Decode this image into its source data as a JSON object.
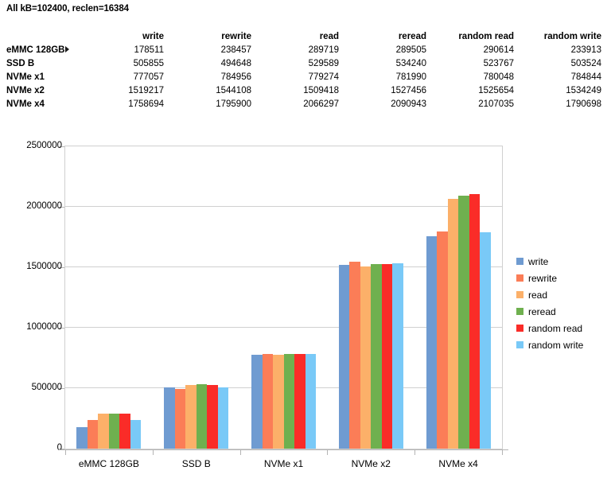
{
  "sheet": {
    "title": "All kB=102400, reclen=16384"
  },
  "table": {
    "corner_label": "",
    "columns": [
      "write",
      "rewrite",
      "read",
      "reread",
      "random read",
      "random write"
    ],
    "rows": [
      {
        "label": "eMMC 128GB",
        "values": [
          178511,
          238457,
          289719,
          289505,
          290614,
          233913
        ],
        "truncated": true
      },
      {
        "label": "SSD B",
        "values": [
          505855,
          494648,
          529589,
          534240,
          523767,
          503524
        ],
        "truncated": false
      },
      {
        "label": "NVMe x1",
        "values": [
          777057,
          784956,
          779274,
          781990,
          780048,
          784844
        ],
        "truncated": false
      },
      {
        "label": "NVMe x2",
        "values": [
          1519217,
          1544108,
          1509418,
          1527456,
          1525654,
          1534249
        ],
        "truncated": false
      },
      {
        "label": "NVMe x4",
        "values": [
          1758694,
          1795900,
          2066297,
          2090943,
          2107035,
          1790698
        ],
        "truncated": false
      }
    ]
  },
  "chart_data": {
    "type": "bar",
    "title": "",
    "xlabel": "",
    "ylabel": "",
    "categories": [
      "eMMC 128GB",
      "SSD B",
      "NVMe x1",
      "NVMe x2",
      "NVMe x4"
    ],
    "series": [
      {
        "name": "write",
        "color": "#6f9bd1",
        "values": [
          178511,
          505855,
          777057,
          1519217,
          1758694
        ]
      },
      {
        "name": "rewrite",
        "color": "#fb7d57",
        "values": [
          238457,
          494648,
          784956,
          1544108,
          1795900
        ]
      },
      {
        "name": "read",
        "color": "#fcb069",
        "values": [
          289719,
          529589,
          779274,
          1509418,
          2066297
        ]
      },
      {
        "name": "reread",
        "color": "#6fb04f",
        "values": [
          289505,
          534240,
          781990,
          1527456,
          2090943
        ]
      },
      {
        "name": "random read",
        "color": "#fa2c28",
        "values": [
          290614,
          523767,
          780048,
          1525654,
          2107035
        ]
      },
      {
        "name": "random write",
        "color": "#79c9f7",
        "values": [
          233913,
          503524,
          784844,
          1534249,
          1790698
        ]
      }
    ],
    "ylim": [
      0,
      2500000
    ],
    "yticks": [
      0,
      500000,
      1000000,
      1500000,
      2000000,
      2500000
    ],
    "ytick_labels": [
      "0",
      "500000",
      "1000000",
      "1500000",
      "2000000",
      "2500000"
    ],
    "grid": true,
    "legend_position": "right"
  }
}
